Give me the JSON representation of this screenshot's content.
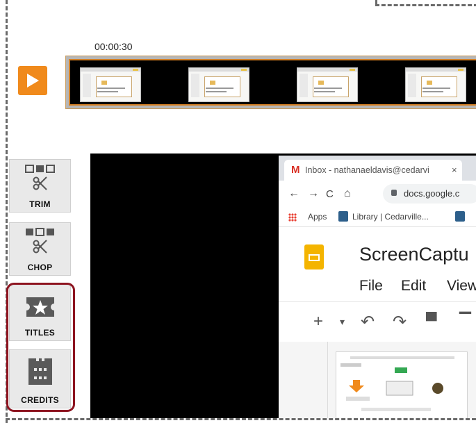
{
  "timeline": {
    "timecode": "00:00:30",
    "thumbnail_count": 4
  },
  "tools": {
    "trim": {
      "label": "TRIM",
      "icon": "trim-scissors-icon"
    },
    "chop": {
      "label": "CHOP",
      "icon": "chop-scissors-icon"
    },
    "titles": {
      "label": "TITLES",
      "icon": "star-title-icon"
    },
    "credits": {
      "label": "CREDITS",
      "icon": "film-credits-icon"
    }
  },
  "browser": {
    "tab_title": "Inbox - nathanaeldavis@cedarvi",
    "tab_close": "×",
    "url": "docs.google.c",
    "bookmarks": {
      "apps": "Apps",
      "library": "Library | Cedarville..."
    },
    "doc_title": "ScreenCaptu",
    "menu": [
      "File",
      "Edit",
      "View"
    ]
  },
  "colors": {
    "accent_orange": "#f08a1c",
    "highlight_red": "#8d1420",
    "tool_bg": "#e9e9e9",
    "icon_gray": "#5a5a5a"
  }
}
